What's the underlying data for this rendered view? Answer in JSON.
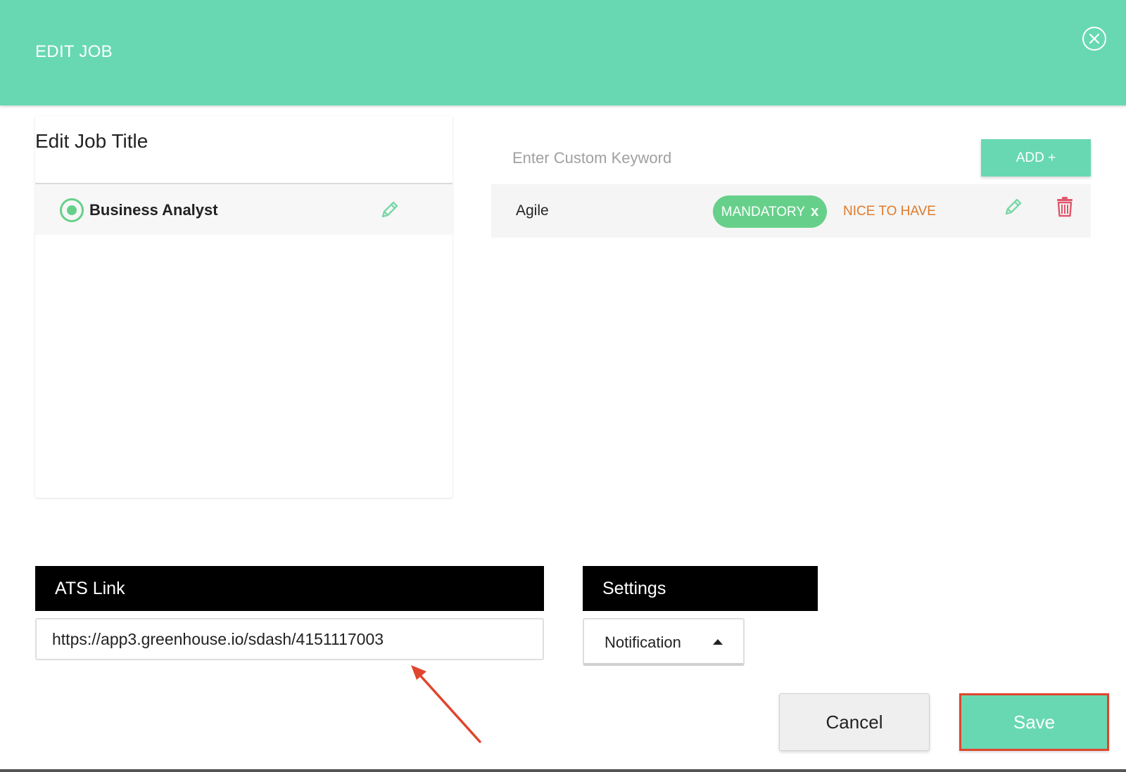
{
  "header": {
    "title": "EDIT JOB",
    "close_icon": "close-circle-icon"
  },
  "job_titles": {
    "heading": "Edit Job Title",
    "items": [
      {
        "label": "Business Analyst",
        "selected": true
      }
    ]
  },
  "keywords": {
    "input_placeholder": "Enter Custom Keyword",
    "input_value": "",
    "add_label": "ADD +",
    "items": [
      {
        "label": "Agile",
        "mandatory_label": "MANDATORY",
        "mandatory_remove": "x",
        "nice_to_have_label": "NICE TO HAVE"
      }
    ]
  },
  "ats": {
    "heading": "ATS Link",
    "value": "https://app3.greenhouse.io/sdash/4151117003"
  },
  "settings": {
    "heading": "Settings",
    "selected": "Notification"
  },
  "actions": {
    "cancel_label": "Cancel",
    "save_label": "Save"
  },
  "colors": {
    "accent": "#68d8b3",
    "mandatory": "#66d08a",
    "nice_to_have": "#e07a2a",
    "delete": "#e0566b",
    "highlight": "#e0452d"
  }
}
